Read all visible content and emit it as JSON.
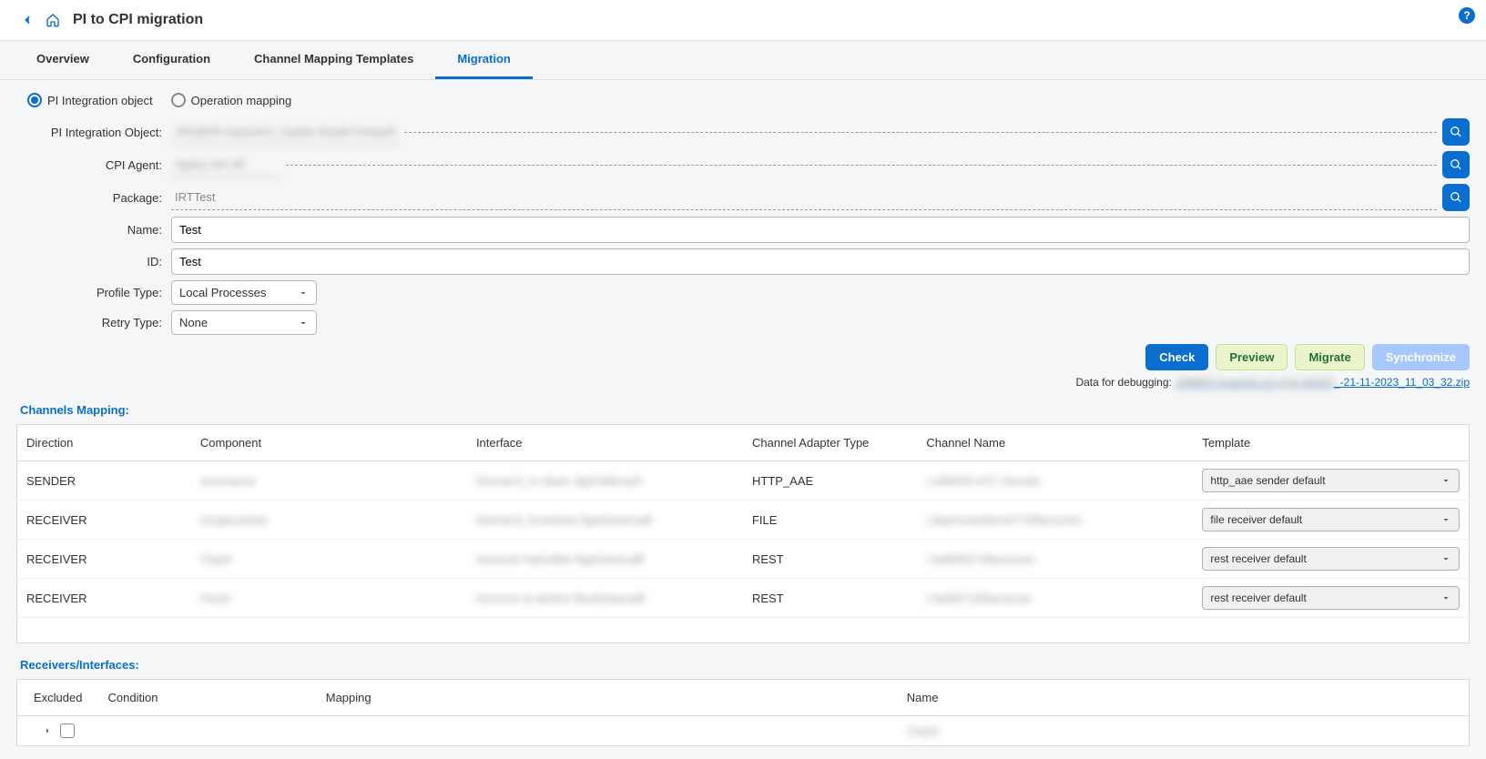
{
  "header": {
    "title": "PI to CPI migration"
  },
  "tabs": {
    "overview": "Overview",
    "configuration": "Configuration",
    "cmt": "Channel Mapping Templates",
    "migration": "Migration"
  },
  "radios": {
    "pi": "PI Integration object",
    "om": "Operation mapping"
  },
  "form": {
    "pio_label": "PI Integration Object:",
    "pio_value": "Jhb3829 masonic1_mylaw shywk hmwyd5j",
    "cpi_label": "CPI Agent:",
    "cpi_value": "ngdou set uR",
    "pkg_label": "Package:",
    "pkg_value": "IRTTest",
    "name_label": "Name:",
    "name_value": "Test",
    "id_label": "ID:",
    "id_value": "Test",
    "profile_label": "Profile Type:",
    "profile_value": "Local Processes",
    "retry_label": "Retry Type:",
    "retry_value": "None"
  },
  "buttons": {
    "check": "Check",
    "preview": "Preview",
    "migrate": "Migrate",
    "sync": "Synchronize"
  },
  "debug": {
    "label": "Data for debugging:",
    "link_blur": "J09MPh fcuamifu af nygit phi023",
    "link_tail": "_-21-11-2023_11_03_32.zip"
  },
  "channels": {
    "title": "Channels Mapping:",
    "headers": {
      "direction": "Direction",
      "component": "Component",
      "interface": "Interface",
      "adapter": "Channel Adapter Type",
      "name": "Channel Name",
      "template": "Template"
    },
    "rows": [
      {
        "direction": "SENDER",
        "component": "resonance",
        "interface": "Demwc3_m nkwe JigsOdiesrp5",
        "adapter": "HTTP_AAE",
        "name": "| nd0028 wTC thesdw",
        "template": "http_aae sender default"
      },
      {
        "direction": "RECEIVER",
        "component": "tmojarusdow",
        "interface": "Demwc3_froAsbow figwDsiwruaff",
        "adapter": "FILE",
        "name": "| Bqsmoweifsm077Dfiarssnes",
        "template": "file receiver default"
      },
      {
        "direction": "RECEIVER",
        "component": "Chpt3",
        "interface": "Inmovck haDclMw figeDsiwruaff",
        "adapter": "REST",
        "name": "| fad0823 Dfiarssnse",
        "template": "rest receiver default"
      },
      {
        "direction": "RECEIVER",
        "component": "Feet3",
        "interface": "Inmovck & darihre flwsDsiwruaff",
        "adapter": "REST",
        "name": "| fad0071Dfiarssnse",
        "template": "rest receiver default"
      }
    ]
  },
  "receivers": {
    "title": "Receivers/Interfaces:",
    "headers": {
      "excluded": "Excluded",
      "condition": "Condition",
      "mapping": "Mapping",
      "name": "Name"
    },
    "rows": [
      {
        "excluded": false,
        "condition": "",
        "mapping": "",
        "name": "Chpt3"
      }
    ]
  }
}
